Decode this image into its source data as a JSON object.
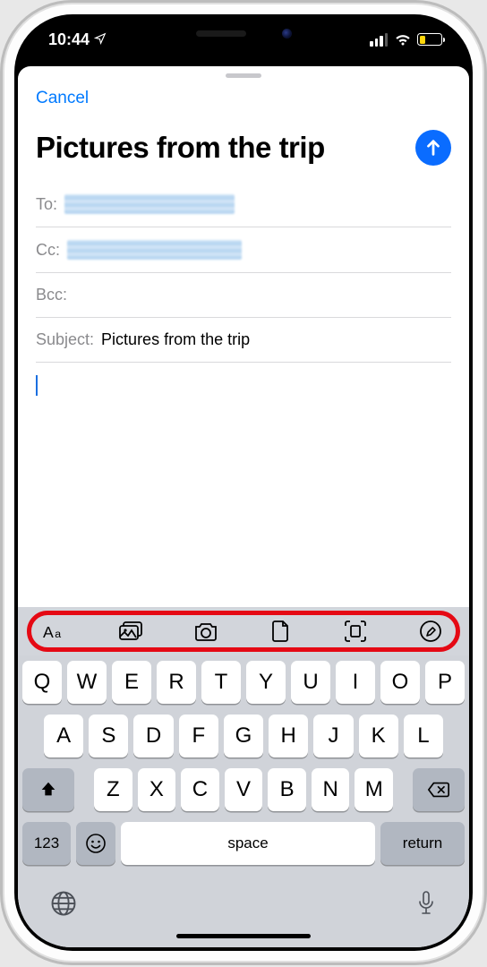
{
  "status": {
    "time": "10:44",
    "location_arrow": true
  },
  "compose": {
    "cancel": "Cancel",
    "title": "Pictures from the trip",
    "fields": {
      "to_label": "To:",
      "cc_label": "Cc:",
      "bcc_label": "Bcc:",
      "subject_label": "Subject:",
      "subject_value": "Pictures from the trip"
    }
  },
  "attach_icons": [
    "text-format-icon",
    "photo-library-icon",
    "camera-icon",
    "document-icon",
    "scan-document-icon",
    "markup-icon"
  ],
  "keyboard": {
    "row1": [
      "Q",
      "W",
      "E",
      "R",
      "T",
      "Y",
      "U",
      "I",
      "O",
      "P"
    ],
    "row2": [
      "A",
      "S",
      "D",
      "F",
      "G",
      "H",
      "J",
      "K",
      "L"
    ],
    "row3": [
      "Z",
      "X",
      "C",
      "V",
      "B",
      "N",
      "M"
    ],
    "num": "123",
    "space": "space",
    "return": "return"
  }
}
